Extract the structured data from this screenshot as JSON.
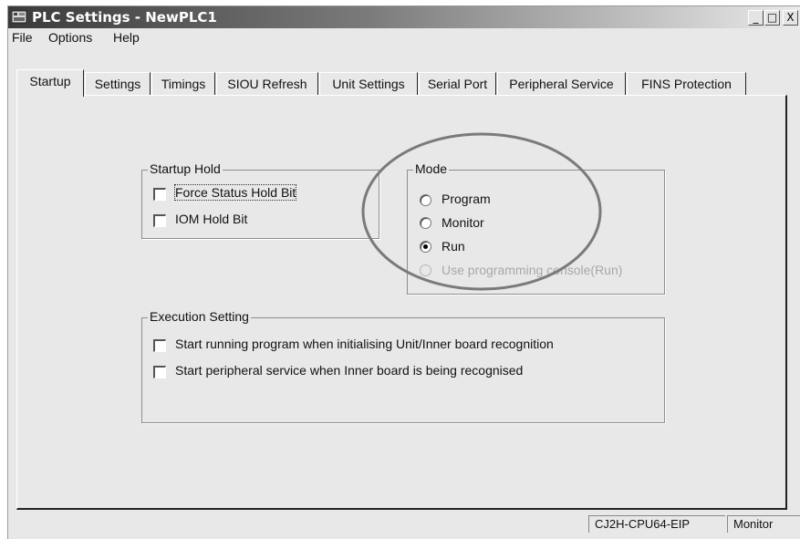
{
  "window": {
    "title": "PLC Settings - NewPLC1"
  },
  "window_controls": {
    "minimize": "_",
    "maximize": "□",
    "close": "X"
  },
  "menubar": {
    "items": [
      "File",
      "Options",
      "Help"
    ]
  },
  "tabs": [
    "Startup",
    "Settings",
    "Timings",
    "SIOU Refresh",
    "Unit Settings",
    "Serial Port",
    "Peripheral Service",
    "FINS Protection"
  ],
  "active_tab": "Startup",
  "startup_hold": {
    "title": "Startup Hold",
    "options": [
      {
        "label": "Force Status Hold Bit",
        "checked": false
      },
      {
        "label": "IOM Hold Bit",
        "checked": false
      }
    ]
  },
  "mode": {
    "title": "Mode",
    "options": [
      {
        "label": "Program",
        "selected": false,
        "enabled": true
      },
      {
        "label": "Monitor",
        "selected": false,
        "enabled": true
      },
      {
        "label": "Run",
        "selected": true,
        "enabled": true
      },
      {
        "label": "Use programming console(Run)",
        "selected": false,
        "enabled": false
      }
    ]
  },
  "execution_setting": {
    "title": "Execution Setting",
    "options": [
      {
        "label": "Start running program when initialising Unit/Inner board recognition",
        "checked": false
      },
      {
        "label": "Start peripheral service when Inner board is being recognised",
        "checked": false
      }
    ]
  },
  "statusbar": {
    "device": "CJ2H-CPU64-EIP",
    "mode": "Monitor"
  },
  "colors": {
    "window_bg": "#e8e8e8",
    "title_dark": "#3a3a3a",
    "highlight_ellipse": "#7a7a7a"
  }
}
